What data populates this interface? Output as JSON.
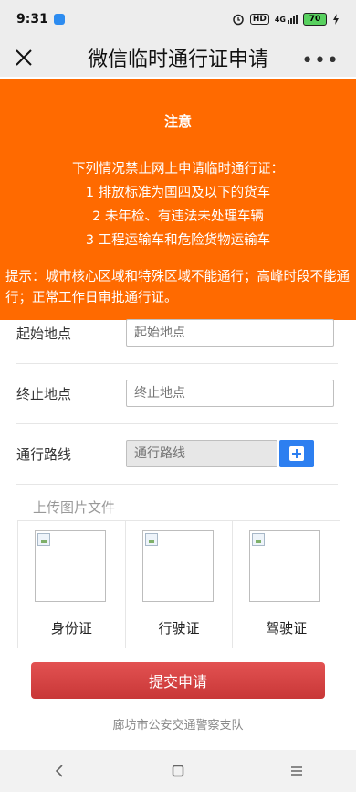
{
  "status_bar": {
    "time": "9:31",
    "icons": [
      "app-notification-icon",
      "alarm-icon",
      "hd-icon",
      "signal-4g-icon",
      "battery-icon",
      "charging-icon"
    ],
    "battery_level": "70",
    "hd_text": "HD",
    "network_text": "4G"
  },
  "title_bar": {
    "title": "微信临时通行证申请",
    "close_icon": "close-icon",
    "more_icon": "more-icon",
    "more_text": "•••"
  },
  "notice": {
    "heading": "注意",
    "intro": "下列情况禁止网上申请临时通行证：",
    "items": [
      "1 排放标准为国四及以下的货车",
      "2 未年检、有违法未处理车辆",
      "3 工程运输车和危险货物运输车"
    ],
    "tip": "提示：城市核心区域和特殊区域不能通行；高峰时段不能通行；正常工作日审批通行证。",
    "background_color": "#ff6a00"
  },
  "form": {
    "start": {
      "label": "起始地点",
      "placeholder": "起始地点",
      "value": ""
    },
    "end": {
      "label": "终止地点",
      "placeholder": "终止地点",
      "value": ""
    },
    "route": {
      "label": "通行路线",
      "placeholder": "通行路线",
      "value": "",
      "add_icon": "plus-icon"
    }
  },
  "upload": {
    "label": "上传图片文件",
    "items": [
      {
        "caption": "身份证"
      },
      {
        "caption": "行驶证"
      },
      {
        "caption": "驾驶证"
      }
    ]
  },
  "submit_label": "提交申请",
  "footer": "廊坊市公安交通警察支队",
  "nav_bar": {
    "icons": [
      "back-icon",
      "home-icon",
      "menu-icon"
    ]
  }
}
